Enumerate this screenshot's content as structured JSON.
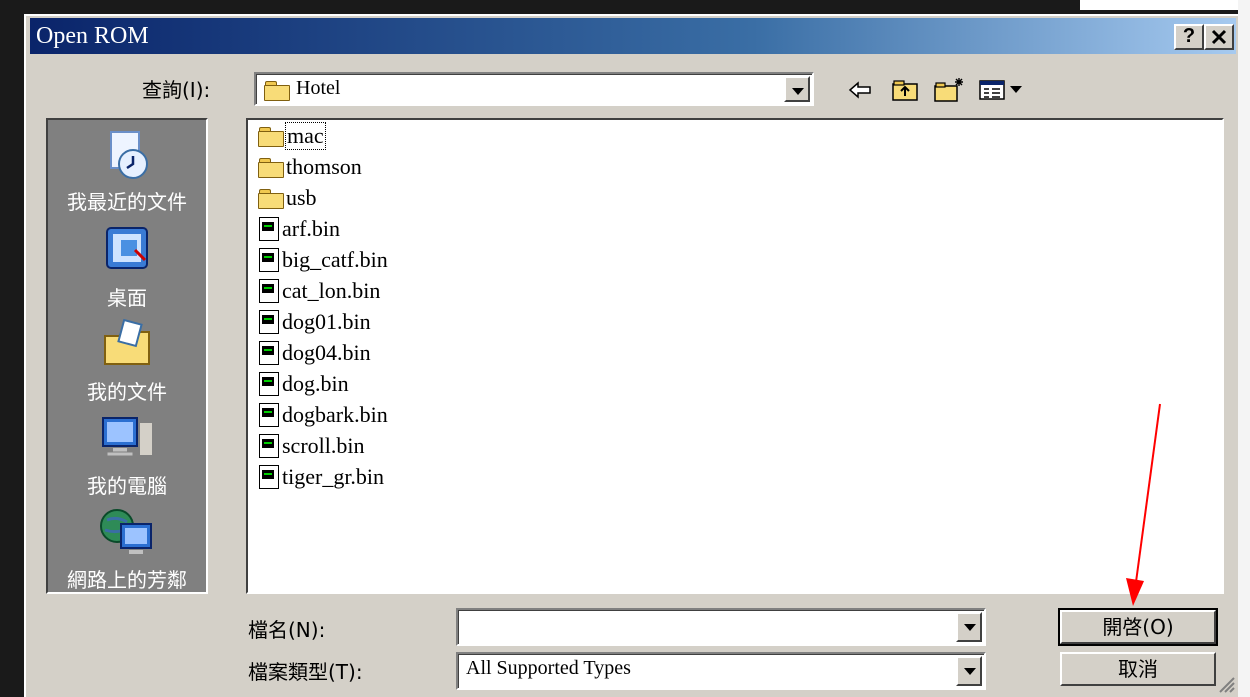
{
  "window": {
    "title": "Open ROM",
    "help_label": "?",
    "close_label": "✕"
  },
  "lookin": {
    "label": "查詢(I):",
    "value": "Hotel"
  },
  "places": [
    {
      "label": "我最近的文件",
      "icon": "recent-documents-icon"
    },
    {
      "label": "桌面",
      "icon": "desktop-icon"
    },
    {
      "label": "我的文件",
      "icon": "my-documents-icon"
    },
    {
      "label": "我的電腦",
      "icon": "my-computer-icon"
    },
    {
      "label": "網路上的芳鄰",
      "icon": "network-places-icon"
    }
  ],
  "files": [
    {
      "name": "mac",
      "type": "folder"
    },
    {
      "name": "thomson",
      "type": "folder"
    },
    {
      "name": "usb",
      "type": "folder"
    },
    {
      "name": "arf.bin",
      "type": "bin"
    },
    {
      "name": "big_catf.bin",
      "type": "bin"
    },
    {
      "name": "cat_lon.bin",
      "type": "bin"
    },
    {
      "name": "dog01.bin",
      "type": "bin"
    },
    {
      "name": "dog04.bin",
      "type": "bin"
    },
    {
      "name": "dog.bin",
      "type": "bin"
    },
    {
      "name": "dogbark.bin",
      "type": "bin"
    },
    {
      "name": "scroll.bin",
      "type": "bin"
    },
    {
      "name": "tiger_gr.bin",
      "type": "bin"
    }
  ],
  "filename": {
    "label": "檔名(N):",
    "value": ""
  },
  "filetype": {
    "label": "檔案類型(T):",
    "value": "All Supported Types"
  },
  "buttons": {
    "open": "開啓(O)",
    "cancel": "取消"
  },
  "colors": {
    "dialog_bg": "#d4d0c8",
    "titlebar_start": "#0a246a",
    "titlebar_end": "#a6caf0",
    "places_bg": "#808080",
    "annotation_arrow": "#ff0000"
  }
}
